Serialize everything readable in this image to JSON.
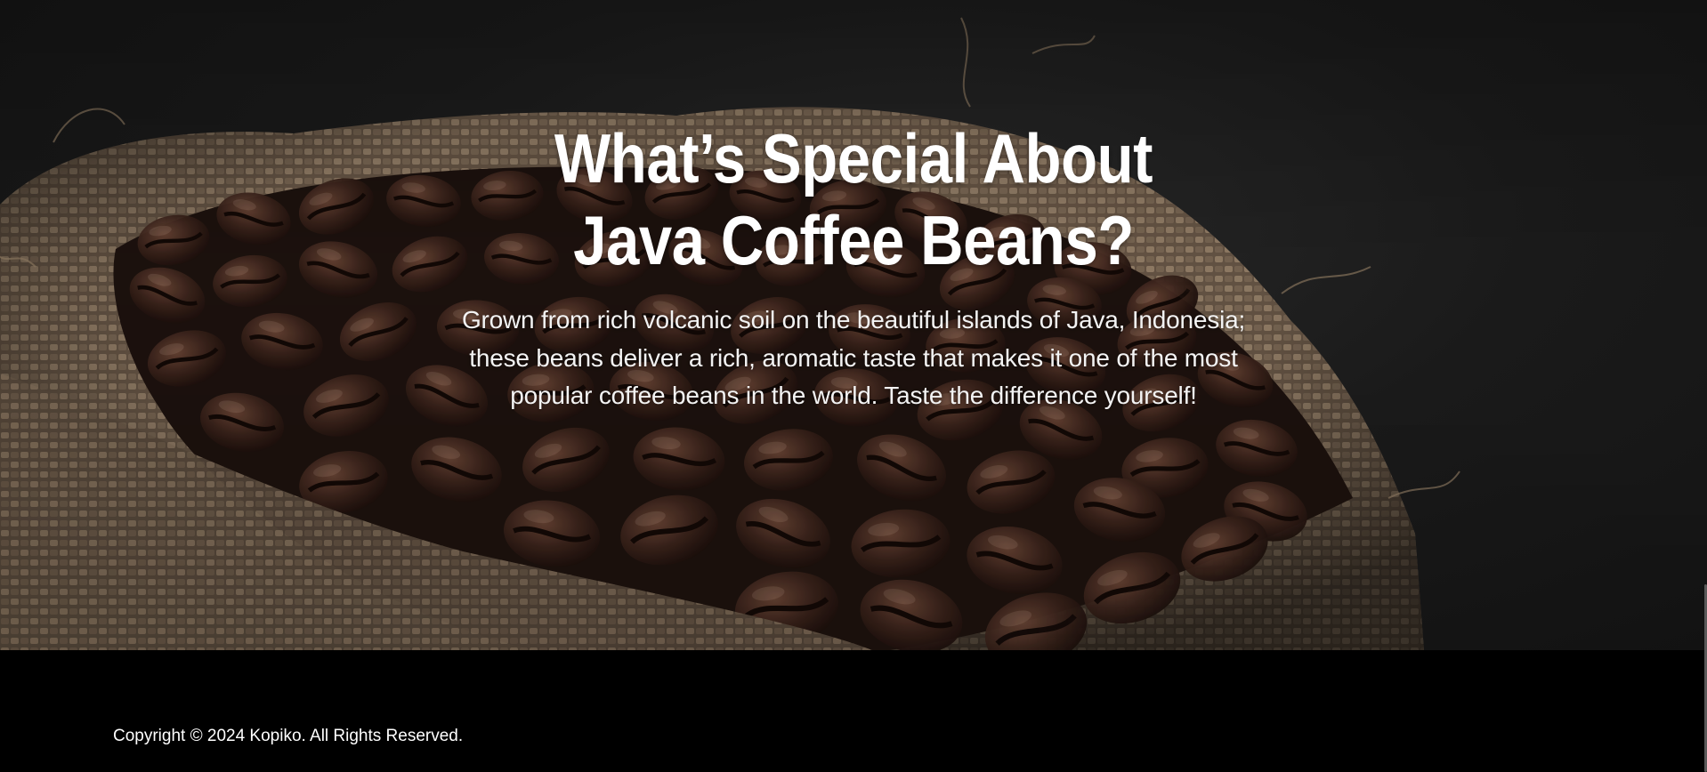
{
  "hero": {
    "title_line1": "What’s Special About",
    "title_line2": "Java Coffee Beans?",
    "description": "Grown from rich volcanic soil on the beautiful islands of Java, Indonesia; these beans deliver a rich, aromatic taste that makes it one of the most popular coffee beans in the world. Taste the difference yourself!",
    "background_image": "coffee-beans-in-burlap-sack-photo"
  },
  "footer": {
    "copyright": "Copyright © 2024 Kopiko. All Rights Reserved."
  },
  "colors": {
    "footer_background": "#000000",
    "hero_text": "#ffffff",
    "bean_color": "#3b241c",
    "burlap_color": "#7a6652"
  }
}
